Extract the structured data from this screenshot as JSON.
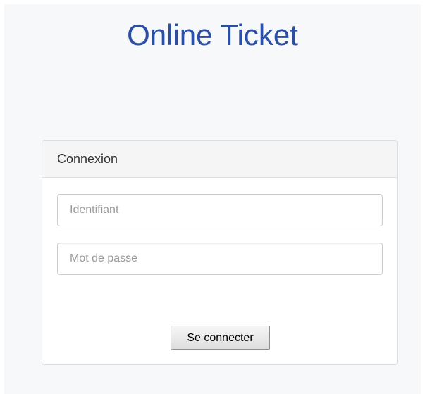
{
  "header": {
    "title": "Online Ticket"
  },
  "login_panel": {
    "heading": "Connexion",
    "username": {
      "value": "",
      "placeholder": "Identifiant"
    },
    "password": {
      "value": "",
      "placeholder": "Mot de passe"
    },
    "submit_label": "Se connecter"
  },
  "colors": {
    "title": "#2b4fa6",
    "page_background": "#f7f8f9",
    "panel_heading_background": "#f5f5f5",
    "border": "#dddddd"
  }
}
